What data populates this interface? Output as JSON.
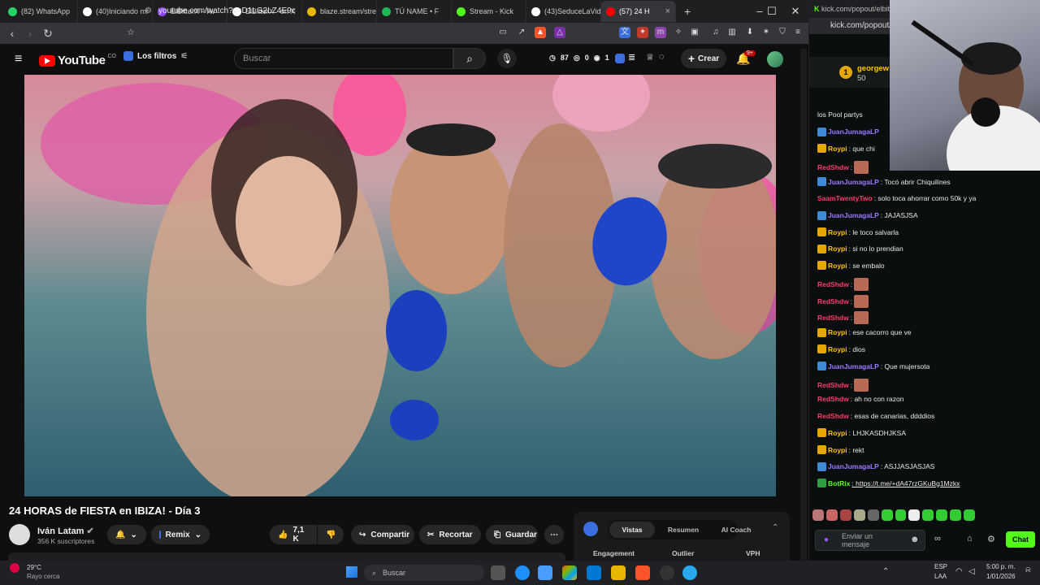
{
  "browser": {
    "tabs": [
      {
        "label": "(82) WhatsApp",
        "color": "#25d366"
      },
      {
        "label": "(40)Iniciando mi",
        "color": "#ffffff"
      },
      {
        "label": "ElBitterX - Tw",
        "color": "#9146ff"
      },
      {
        "label": "ElBitterX · on X",
        "color": "#ffffff"
      },
      {
        "label": "blaze.stream/stre",
        "color": "#e6b800"
      },
      {
        "label": "TÚ NAME • F",
        "color": "#1db954"
      },
      {
        "label": "Stream - Kick",
        "color": "#53fc18"
      },
      {
        "label": "(43)SeduceLaVid",
        "color": "#ffffff"
      },
      {
        "label": "(57) 24 H",
        "color": "#ff0000"
      }
    ],
    "new_tab": "+",
    "url": "youtube.com/watch?v=D1LG2LZ4E9c"
  },
  "youtube": {
    "logo": "YouTube",
    "logo_sup": "CO",
    "filters_label": "Los filtros",
    "search_placeholder": "Buscar",
    "stats": {
      "views": "87",
      "eye": "0",
      "other": "1"
    },
    "create_label": "Crear",
    "notif_count": "9+",
    "video_title": "24 HORAS de FIESTA en IBIZA! - Día 3",
    "channel_name": "Iván Latam",
    "subscribers": "356 K suscriptores",
    "remix_label": "Remix",
    "likes": "7,1 K",
    "share_label": "Compartir",
    "clip_label": "Recortar",
    "save_label": "Guardar",
    "panel_tabs": [
      "Vistas",
      "Resumen",
      "AI Coach"
    ],
    "panel_cols": [
      "Engagement",
      "Outlier",
      "VPH"
    ]
  },
  "kick": {
    "url": "kick.com/popout/elbitt",
    "url2": "kick.com/popout/",
    "top_user": "georgew",
    "top_user_amount": "50",
    "chat": [
      {
        "user": "",
        "text": "los Pool partys",
        "color": "#e8e8e8"
      },
      {
        "user": "JuanJumagaLP",
        "text": "",
        "color": "#9b7bff"
      },
      {
        "user": "Roypi",
        "text": ": que chi",
        "color": "#ffc400"
      },
      {
        "user": "RedShdw",
        "text": ":",
        "color": "#ff3b6b"
      },
      {
        "user": "JuanJumagaLP",
        "text": ": Tocó abrir Chiquilines",
        "color": "#9b7bff"
      },
      {
        "user": "SaamTwentyTwo",
        "text": ": solo toca ahorrar como 50k y ya",
        "color": "#ff3b6b"
      },
      {
        "user": "JuanJumagaLP",
        "text": ": JAJASJSA",
        "color": "#9b7bff"
      },
      {
        "user": "Roypi",
        "text": ": le toco salvarla",
        "color": "#ffc400"
      },
      {
        "user": "Roypi",
        "text": ": si no lo prendian",
        "color": "#ffc400"
      },
      {
        "user": "Roypi",
        "text": ": se embalo",
        "color": "#ffc400"
      },
      {
        "user": "RedShdw",
        "text": ":",
        "color": "#ff3b6b"
      },
      {
        "user": "RedShdw",
        "text": ":",
        "color": "#ff3b6b"
      },
      {
        "user": "RedShdw",
        "text": ":",
        "color": "#ff3b6b"
      },
      {
        "user": "Roypi",
        "text": ": ese cacorro que ve",
        "color": "#ffc400"
      },
      {
        "user": "Roypi",
        "text": ": dios",
        "color": "#ffc400"
      },
      {
        "user": "JuanJumagaLP",
        "text": ": Que mujersota",
        "color": "#9b7bff"
      },
      {
        "user": "RedShdw",
        "text": ":",
        "color": "#ff3b6b"
      },
      {
        "user": "RedShdw",
        "text": ": ah no con razon",
        "color": "#ff3b6b"
      },
      {
        "user": "RedShdw",
        "text": ": esas de canarias, ddddios",
        "color": "#ff3b6b"
      },
      {
        "user": "Roypi",
        "text": ": LHJKASDHJKSA",
        "color": "#ffc400"
      },
      {
        "user": "Roypi",
        "text": ": rekt",
        "color": "#ffc400"
      },
      {
        "user": "JuanJumagaLP",
        "text": ": ASJJASJASJAS",
        "color": "#9b7bff"
      },
      {
        "user": "BotRix",
        "text": ": https://t.me/+dA47rzGKuBg1Mzkx",
        "color": "#53fc18"
      }
    ],
    "input_placeholder": "Enviar un mensaje",
    "chat_button": "Chat"
  },
  "taskbar": {
    "weather_temp": "29°C",
    "weather_desc": "Rayo cerca",
    "search": "Buscar",
    "lang": "ESP",
    "lang2": "LAA",
    "time": "5:00 p. m.",
    "date": "1/01/2026"
  }
}
